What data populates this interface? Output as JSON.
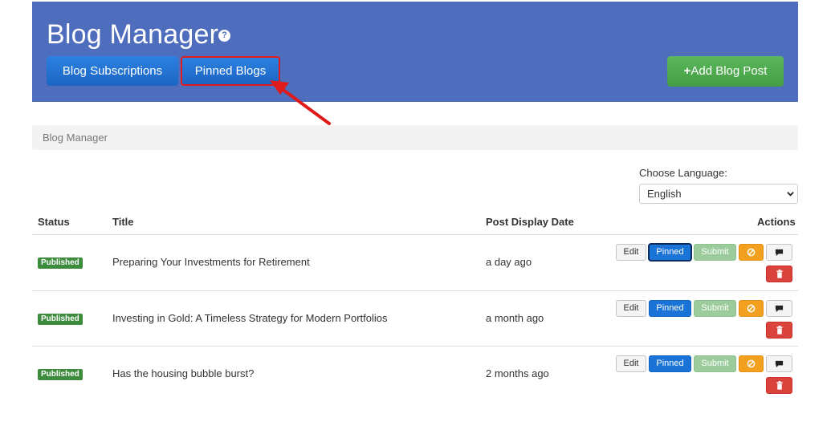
{
  "header": {
    "title": "Blog Manager",
    "help_icon": "question-circle-icon",
    "tabs": [
      {
        "label": "Blog Subscriptions"
      },
      {
        "label": "Pinned Blogs"
      }
    ],
    "add_button_label": "Add Blog Post",
    "add_button_icon": "plus-icon"
  },
  "breadcrumb": {
    "current": "Blog Manager"
  },
  "language": {
    "label": "Choose Language:",
    "selected": "English"
  },
  "table": {
    "columns": [
      "Status",
      "Title",
      "Post Display Date",
      "Actions"
    ],
    "rows": [
      {
        "status": "Published",
        "title": "Preparing Your Investments for Retirement",
        "date": "a day ago"
      },
      {
        "status": "Published",
        "title": "Investing in Gold: A Timeless Strategy for Modern Portfolios",
        "date": "a month ago"
      },
      {
        "status": "Published",
        "title": "Has the housing bubble burst?",
        "date": "2 months ago"
      }
    ],
    "actions": {
      "edit": "Edit",
      "pinned": "Pinned",
      "submit": "Submit",
      "block_icon": "ban-icon",
      "comment_icon": "comment-icon",
      "delete_icon": "trash-icon"
    }
  },
  "colors": {
    "header_bg": "#4f6dbd",
    "primary_button": "#1c64c4",
    "success_button": "#5cb85c",
    "highlight_border": "#e01b1b",
    "published_badge": "#3d8b3d",
    "warning_button": "#f2a01e",
    "danger_button": "#d9433b"
  }
}
